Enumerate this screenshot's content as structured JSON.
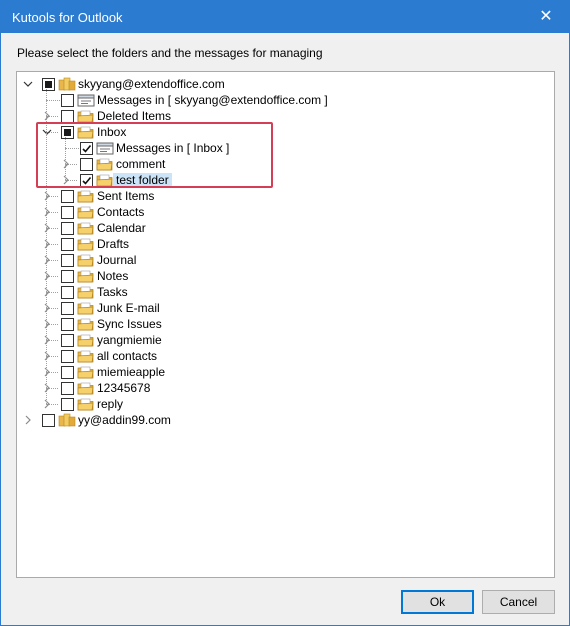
{
  "window": {
    "title": "Kutools for Outlook",
    "close_glyph": "✕",
    "accent_color": "#2b7bd0"
  },
  "instruction": "Please select the folders and the messages for managing",
  "tree": {
    "accounts": [
      {
        "label": "skyyang@extendoffice.com",
        "expanded": true,
        "check_state": "partial",
        "icon": "account-folder-icon",
        "children": [
          {
            "label": "Messages in [ skyyang@extendoffice.com ]",
            "type": "messages",
            "check_state": "unchecked",
            "icon": "messages-icon"
          },
          {
            "label": "Deleted Items",
            "check_state": "unchecked",
            "icon": "folder-icon",
            "expandable": true
          },
          {
            "label": "Inbox",
            "expanded": true,
            "check_state": "partial",
            "icon": "folder-icon",
            "children": [
              {
                "label": "Messages in [ Inbox ]",
                "type": "messages",
                "check_state": "checked",
                "icon": "messages-icon"
              },
              {
                "label": "comment",
                "check_state": "unchecked",
                "icon": "folder-icon",
                "expandable": true
              },
              {
                "label": "test folder",
                "check_state": "checked",
                "icon": "folder-icon",
                "expandable": true,
                "selected": true
              }
            ]
          },
          {
            "label": "Sent Items",
            "check_state": "unchecked",
            "icon": "folder-icon",
            "expandable": true
          },
          {
            "label": "Contacts",
            "check_state": "unchecked",
            "icon": "folder-icon",
            "expandable": true
          },
          {
            "label": "Calendar",
            "check_state": "unchecked",
            "icon": "folder-icon",
            "expandable": true
          },
          {
            "label": "Drafts",
            "check_state": "unchecked",
            "icon": "folder-icon",
            "expandable": true
          },
          {
            "label": "Journal",
            "check_state": "unchecked",
            "icon": "folder-icon",
            "expandable": true
          },
          {
            "label": "Notes",
            "check_state": "unchecked",
            "icon": "folder-icon",
            "expandable": true
          },
          {
            "label": "Tasks",
            "check_state": "unchecked",
            "icon": "folder-icon",
            "expandable": true
          },
          {
            "label": "Junk E-mail",
            "check_state": "unchecked",
            "icon": "folder-icon",
            "expandable": true
          },
          {
            "label": "Sync Issues",
            "check_state": "unchecked",
            "icon": "folder-icon",
            "expandable": true
          },
          {
            "label": "yangmiemie",
            "check_state": "unchecked",
            "icon": "folder-icon",
            "expandable": true
          },
          {
            "label": "all contacts",
            "check_state": "unchecked",
            "icon": "folder-icon",
            "expandable": true
          },
          {
            "label": "miemieapple",
            "check_state": "unchecked",
            "icon": "folder-icon",
            "expandable": true
          },
          {
            "label": "12345678",
            "check_state": "unchecked",
            "icon": "folder-icon",
            "expandable": true
          },
          {
            "label": "reply",
            "check_state": "unchecked",
            "icon": "folder-icon",
            "expandable": true
          }
        ]
      },
      {
        "label": "yy@addin99.com",
        "expanded": false,
        "check_state": "unchecked",
        "icon": "account-folder-icon"
      }
    ]
  },
  "highlight_color": "#d43f56",
  "buttons": {
    "ok": "Ok",
    "cancel": "Cancel"
  }
}
